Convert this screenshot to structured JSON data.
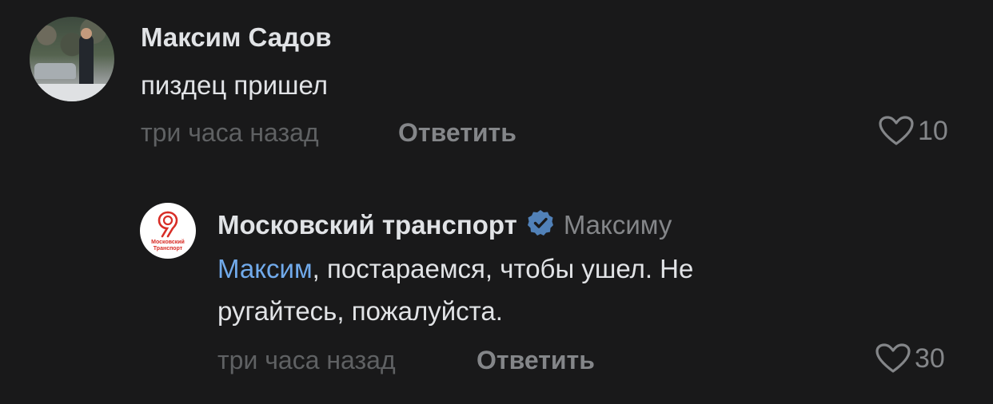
{
  "comments": [
    {
      "author": "Максим Садов",
      "text": "пиздец пришел",
      "time": "три часа назад",
      "reply_label": "Ответить",
      "likes": "10",
      "avatar_icon": "user-photo"
    },
    {
      "author": "Московский транспорт",
      "verified": true,
      "reply_to": "Максиму",
      "mention": "Максим",
      "text_line1_rest": ", постараемся, чтобы ушел. Не",
      "text_line2": "ругайтесь, пожалуйста.",
      "time": "три часа назад",
      "reply_label": "Ответить",
      "likes": "30",
      "avatar_logo_text_line1": "Московский",
      "avatar_logo_text_line2": "Транспорт",
      "avatar_icon": "mostrans-logo"
    }
  ],
  "colors": {
    "background": "#19191a",
    "text": "#e1e3e6",
    "secondary": "#848689",
    "time": "#5f6163",
    "link": "#71aaeb",
    "verified": "#5181b8",
    "logo_red": "#d82d26"
  }
}
